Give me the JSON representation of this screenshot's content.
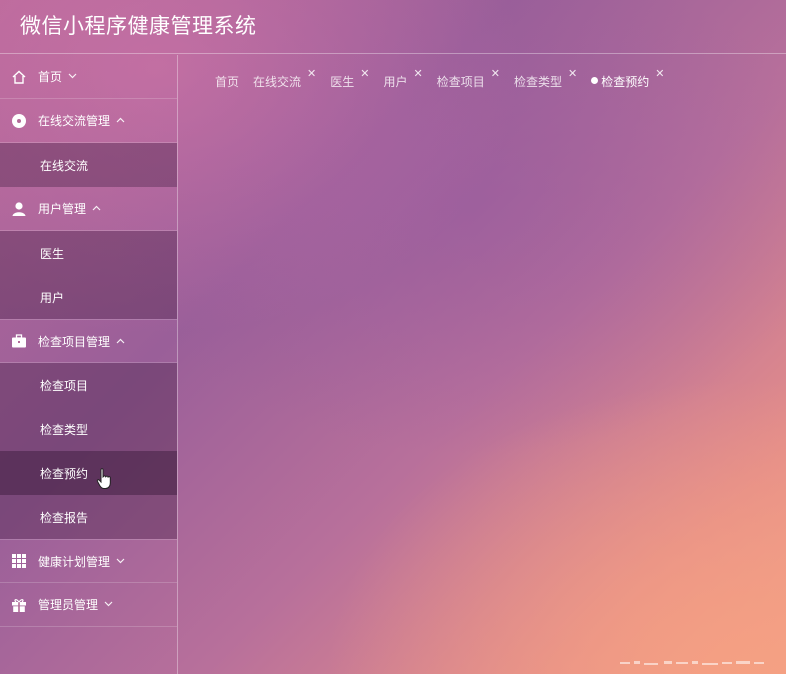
{
  "header": {
    "title": "微信小程序健康管理系统"
  },
  "sidebar": {
    "menus": [
      {
        "label": "首页",
        "icon": "home-icon",
        "arrow": "⌄",
        "children": []
      },
      {
        "label": "在线交流管理",
        "icon": "chat-bubble-icon",
        "arrow": "^",
        "children": [
          {
            "label": "在线交流"
          }
        ]
      },
      {
        "label": "用户管理",
        "icon": "user-icon",
        "arrow": "^",
        "children": [
          {
            "label": "医生"
          },
          {
            "label": "用户"
          }
        ]
      },
      {
        "label": "检查项目管理",
        "icon": "briefcase-icon",
        "arrow": "^",
        "children": [
          {
            "label": "检查项目"
          },
          {
            "label": "检查类型"
          },
          {
            "label": "检查预约",
            "active": true
          },
          {
            "label": "检查报告"
          }
        ]
      },
      {
        "label": "健康计划管理",
        "icon": "grid-icon",
        "arrow": "⌄",
        "children": []
      },
      {
        "label": "管理员管理",
        "icon": "gift-icon",
        "arrow": "⌄",
        "children": []
      }
    ]
  },
  "tabs": [
    {
      "label": "首页",
      "closable": false
    },
    {
      "label": "在线交流",
      "closable": true
    },
    {
      "label": "医生",
      "closable": true
    },
    {
      "label": "用户",
      "closable": true
    },
    {
      "label": "检查项目",
      "closable": true
    },
    {
      "label": "检查类型",
      "closable": true
    },
    {
      "label": "检查预约",
      "closable": true,
      "active": true
    }
  ],
  "close_glyph": "✕"
}
